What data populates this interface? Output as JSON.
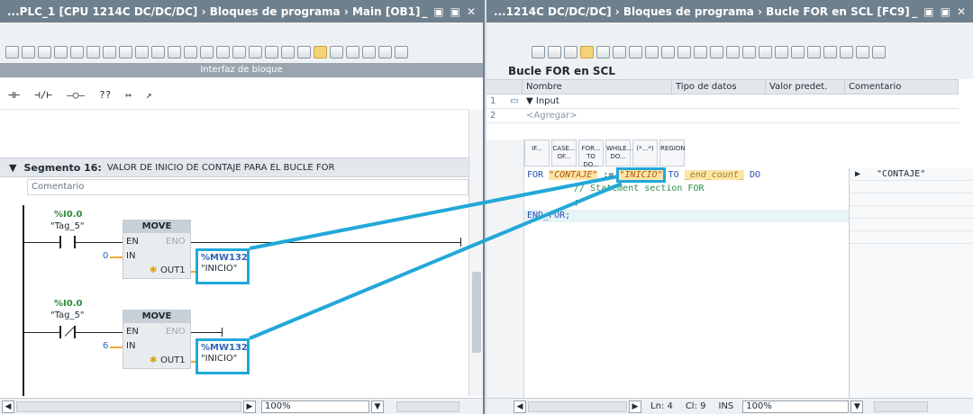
{
  "left": {
    "title": "...PLC_1 [CPU 1214C DC/DC/DC]  ›  Bloques de programa  ›  Main [OB1]",
    "win_ctrls": [
      "_",
      "▣",
      "▣",
      "✕"
    ],
    "interface_label": "Interfaz de bloque",
    "ladder_icons": [
      "⊣⊢",
      "⊣/⊢",
      "–○–",
      "??",
      "↦",
      "↗"
    ],
    "segment_label": "Segmento 16:",
    "segment_title": "VALOR DE INICIO DE CONTAJE PARA EL BUCLE FOR",
    "comment": "Comentario",
    "net1": {
      "contact_addr": "%I0.0",
      "contact_tag": "\"Tag_5\"",
      "block": "MOVE",
      "en": "EN",
      "eno": "ENO",
      "in": "IN",
      "out": "OUT1",
      "in_value": "0",
      "out_addr": "%MW132",
      "out_tag": "\"INICIO\""
    },
    "net2": {
      "contact_addr": "%I0.0",
      "contact_tag": "\"Tag_5\"",
      "block": "MOVE",
      "en": "EN",
      "eno": "ENO",
      "in": "IN",
      "out": "OUT1",
      "in_value": "6",
      "out_addr": "%MW132",
      "out_tag": "\"INICIO\""
    },
    "status": {
      "zoom": "100%"
    }
  },
  "right": {
    "title": "...1214C DC/DC/DC]  ›  Bloques de programa  ›  Bucle FOR en SCL [FC9]",
    "win_ctrls": [
      "_",
      "▣",
      "▣",
      "✕"
    ],
    "block_name": "Bucle FOR en SCL",
    "iface_headers": [
      "Nombre",
      "Tipo de datos",
      "Valor predet.",
      "Comentario"
    ],
    "iface_rows": [
      {
        "num": "1",
        "name": "Input"
      },
      {
        "num": "2",
        "name": "<Agregar>"
      }
    ],
    "scl_tools": [
      "IF...",
      "CASE... OF...",
      "FOR... TO DO...",
      "WHILE... DO...",
      "(*...*)",
      "REGION"
    ],
    "code": {
      "line1_kw1": "FOR",
      "line1_var": "\"CONTAJE\"",
      "line1_assign": ":=",
      "line1_start": "\"INICIO\"",
      "line1_kw2": "TO",
      "line1_end": "_end_count_",
      "line1_kw3": "DO",
      "line2": "// Statement section FOR",
      "line3": ";",
      "line4": "END_FOR;"
    },
    "watch_value": "\"CONTAJE\"",
    "status": {
      "ln": "Ln: 4",
      "cl": "Cl: 9",
      "ins": "INS",
      "zoom": "100%"
    }
  }
}
